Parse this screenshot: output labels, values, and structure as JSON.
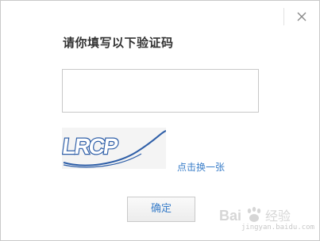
{
  "dialog": {
    "title": "请你填写以下验证码",
    "input": {
      "value": "",
      "placeholder": ""
    },
    "captcha": {
      "text": "LRCP"
    },
    "refresh_link": "点击换一张",
    "confirm_button": "确定",
    "close_icon": "close-icon"
  },
  "watermark": {
    "logo": "Bai 经验",
    "url": "jingyan.baidu.com"
  },
  "colors": {
    "link": "#3a7ec9",
    "title": "#333333",
    "captcha_text": "#2f5fa8",
    "border": "#c8c8c8"
  }
}
